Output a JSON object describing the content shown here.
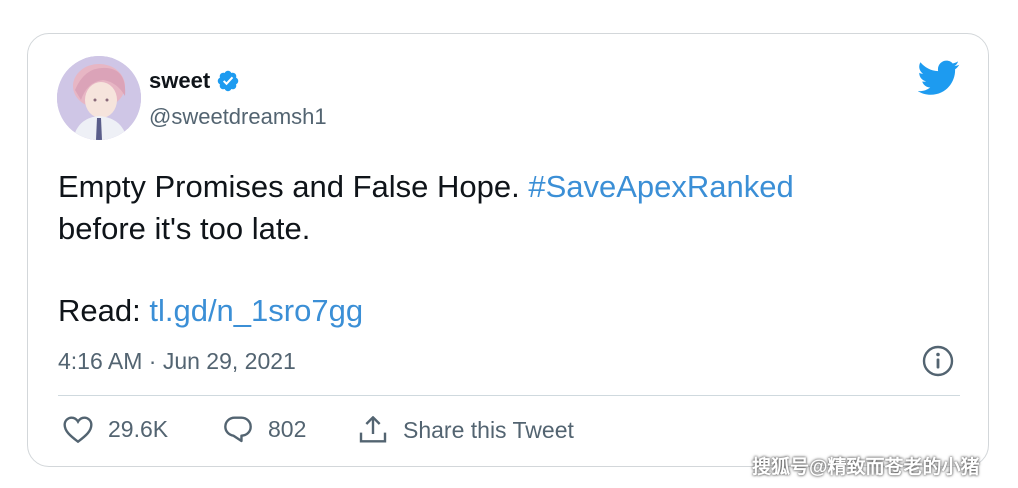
{
  "tweet": {
    "display_name": "sweet",
    "handle": "@sweetdreamsh1",
    "text_part1": "Empty Promises and False Hope. ",
    "hashtag": "#SaveApexRanked",
    "text_part2": "before it's too late.",
    "read_label": "Read: ",
    "read_link": "tl.gd/n_1sro7gg",
    "timestamp": "4:16 AM · Jun 29, 2021"
  },
  "actions": {
    "likes": "29.6K",
    "replies": "802",
    "share_label": "Share this Tweet"
  },
  "watermark": "搜狐号@精致而苍老的小猪",
  "colors": {
    "link": "#3b8fd6",
    "verified": "#1d9bf0",
    "twitter_blue": "#1d9bf0"
  },
  "icons": [
    "verified-badge-icon",
    "twitter-bird-icon",
    "info-icon",
    "heart-icon",
    "reply-icon",
    "share-icon"
  ]
}
